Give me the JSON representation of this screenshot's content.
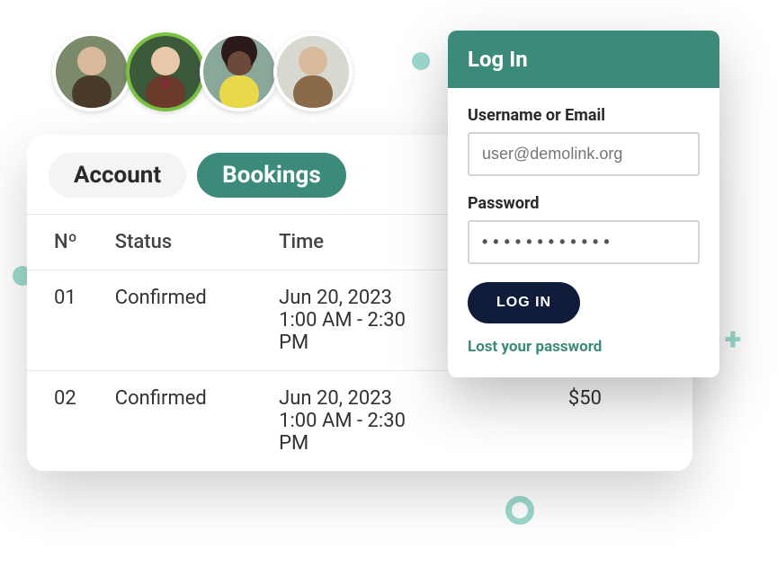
{
  "tabs": {
    "account": "Account",
    "bookings": "Bookings"
  },
  "table": {
    "headers": {
      "no": "Nº",
      "status": "Status",
      "time": "Time",
      "price": ""
    },
    "rows": [
      {
        "no": "01",
        "status": "Confirmed",
        "time": "Jun 20, 2023\n1:00 AM - 2:30\nPM",
        "price": ""
      },
      {
        "no": "02",
        "status": "Confirmed",
        "time": "Jun 20, 2023\n1:00 AM - 2:30\nPM",
        "price": "$50"
      }
    ]
  },
  "login": {
    "title": "Log In",
    "username_label": "Username or Email",
    "username_placeholder": "user@demolink.org",
    "password_label": "Password",
    "password_value": "••••••••••••",
    "button": "LOG IN",
    "lost": "Lost your password"
  },
  "avatars": [
    {
      "name": "avatar-1",
      "highlight": false
    },
    {
      "name": "avatar-2",
      "highlight": true
    },
    {
      "name": "avatar-3",
      "highlight": false
    },
    {
      "name": "avatar-4",
      "highlight": false
    }
  ]
}
